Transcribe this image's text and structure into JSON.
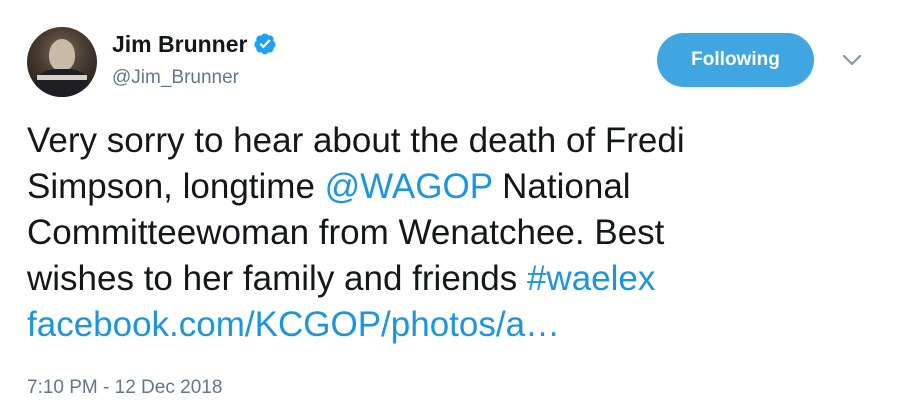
{
  "author": {
    "name": "Jim Brunner",
    "handle": "@Jim_Brunner",
    "verified_icon": "verified-badge-icon",
    "avatar": "avatar-photo"
  },
  "actions": {
    "follow_label": "Following",
    "menu_icon": "chevron-down-icon"
  },
  "tweet": {
    "text_line1": "Very sorry to hear about the death of Fredi",
    "text_line2_a": "Simpson, longtime ",
    "mention": "@WAGOP",
    "text_line2_b": " National",
    "text_line3": "Committeewoman from Wenatchee. Best",
    "text_line4_a": "wishes to her family and friends ",
    "hashtag": "#waelex",
    "link": "facebook.com/KCGOP/photos/a…",
    "timestamp": "7:10 PM - 12 Dec 2018"
  },
  "colors": {
    "accent": "#1b95e0",
    "button": "#3fa6e2",
    "muted": "#657786",
    "text": "#14171a"
  }
}
